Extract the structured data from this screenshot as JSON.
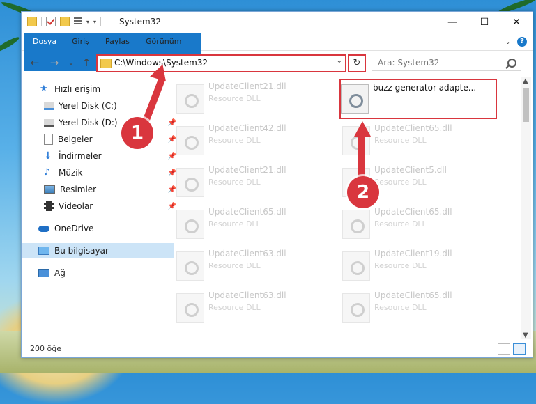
{
  "window": {
    "title": "System32",
    "controls": {
      "minimize": "—",
      "maximize": "☐",
      "close": "✕"
    }
  },
  "ribbon": {
    "tabs": [
      {
        "label": "Dosya",
        "active": true
      },
      {
        "label": "Giriş"
      },
      {
        "label": "Paylaş"
      },
      {
        "label": "Görünüm"
      }
    ]
  },
  "nav": {
    "back": "←",
    "forward": "→",
    "recent": "⌄",
    "up": "↑",
    "address": "C:\\Windows\\System32",
    "refresh": "↻",
    "search_placeholder": "Ara: System32"
  },
  "sidebar": {
    "items": [
      {
        "label": "Hızlı erişim",
        "icon": "star-icon",
        "pinned": false
      },
      {
        "label": "Yerel Disk (C:)",
        "icon": "drive-icon",
        "pinned": false
      },
      {
        "label": "Yerel Disk (D:)",
        "icon": "drive-icon",
        "pinned": true
      },
      {
        "label": "Belgeler",
        "icon": "documents-icon",
        "pinned": true
      },
      {
        "label": "İndirmeler",
        "icon": "download-icon",
        "pinned": true
      },
      {
        "label": "Müzik",
        "icon": "music-icon",
        "pinned": true
      },
      {
        "label": "Resimler",
        "icon": "pictures-icon",
        "pinned": true
      },
      {
        "label": "Videolar",
        "icon": "video-icon",
        "pinned": true
      },
      {
        "label": "OneDrive",
        "icon": "cloud-icon",
        "pinned": false
      },
      {
        "label": "Bu bilgisayar",
        "icon": "computer-icon",
        "pinned": false,
        "selected": true
      },
      {
        "label": "Ağ",
        "icon": "network-icon",
        "pinned": false
      }
    ]
  },
  "files": [
    {
      "name": "UpdateClient21.dll",
      "type": "Resource DLL"
    },
    {
      "name": "buzz generator adapte...",
      "type": "",
      "highlighted": true
    },
    {
      "name": "UpdateClient42.dll",
      "type": "Resource DLL"
    },
    {
      "name": "UpdateClient65.dll",
      "type": "Resource DLL"
    },
    {
      "name": "UpdateClient21.dll",
      "type": "Resource DLL"
    },
    {
      "name": "UpdateClient5.dll",
      "type": "Resource DLL"
    },
    {
      "name": "UpdateClient65.dll",
      "type": "Resource DLL"
    },
    {
      "name": "UpdateClient65.dll",
      "type": "Resource DLL"
    },
    {
      "name": "UpdateClient63.dll",
      "type": "Resource DLL"
    },
    {
      "name": "UpdateClient19.dll",
      "type": "Resource DLL"
    },
    {
      "name": "UpdateClient63.dll",
      "type": "Resource DLL"
    },
    {
      "name": "UpdateClient65.dll",
      "type": "Resource DLL"
    }
  ],
  "status": {
    "item_count": "200 öğe"
  },
  "annotations": {
    "step1": "1",
    "step2": "2"
  },
  "colors": {
    "accent": "#1979ca",
    "highlight": "#d9363e"
  }
}
